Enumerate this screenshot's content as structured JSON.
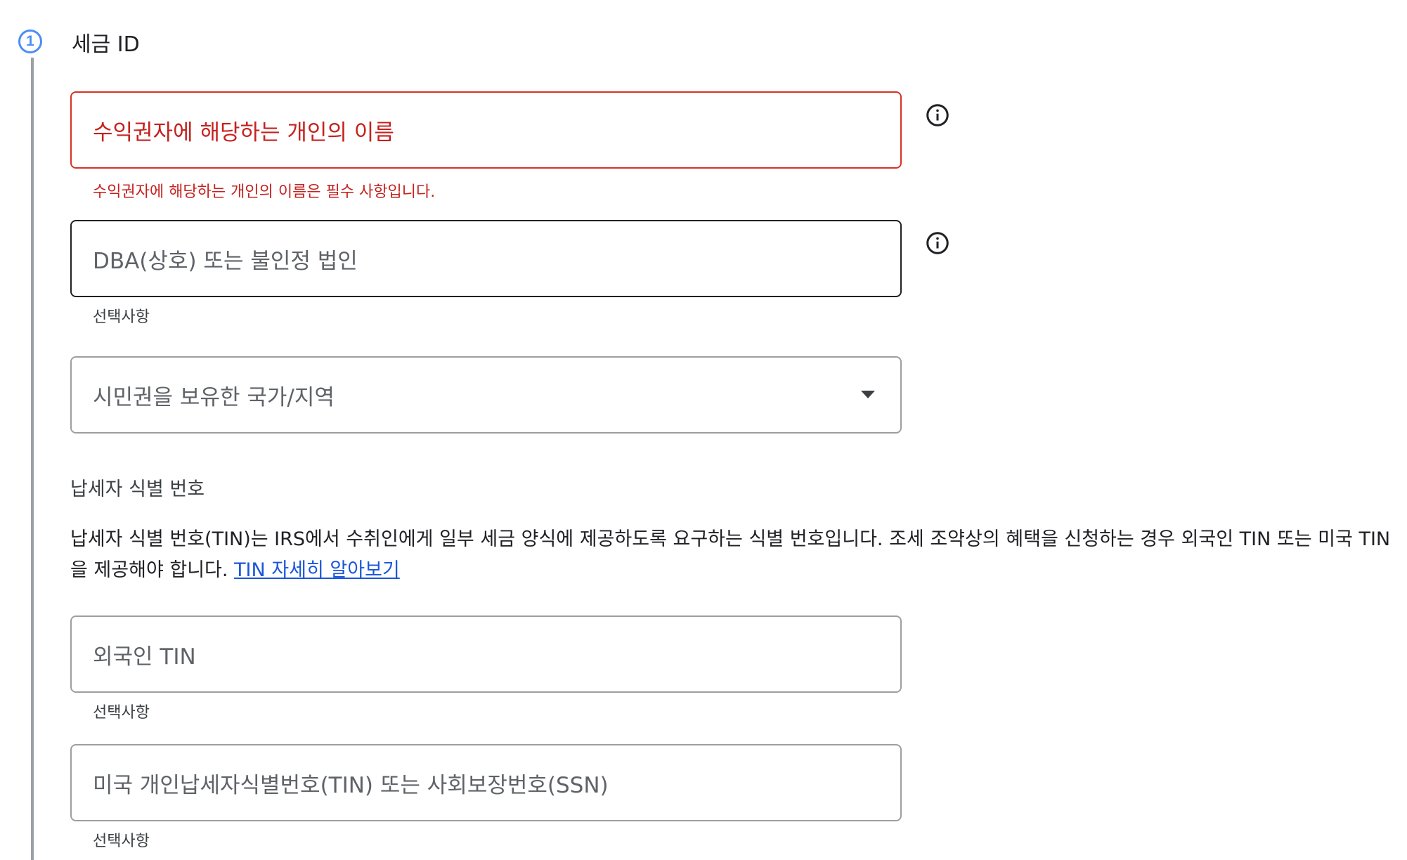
{
  "step": {
    "number": "1",
    "title": "세금 ID"
  },
  "fields": {
    "beneficiary_name": {
      "placeholder": "수익권자에 해당하는 개인의 이름",
      "error": "수익권자에 해당하는 개인의 이름은 필수 사항입니다."
    },
    "dba": {
      "placeholder": "DBA(상호) 또는 불인정 법인",
      "helper": "선택사항"
    },
    "citizenship": {
      "placeholder": "시민권을 보유한 국가/지역"
    },
    "foreign_tin": {
      "placeholder": "외국인 TIN",
      "helper": "선택사항"
    },
    "us_tin": {
      "placeholder": "미국 개인납세자식별번호(TIN) 또는 사회보장번호(SSN)",
      "helper": "선택사항"
    }
  },
  "tin_section": {
    "label": "납세자 식별 번호",
    "description": "납세자 식별 번호(TIN)는 IRS에서 수취인에게 일부 세금 양식에 제공하도록 요구하는 식별 번호입니다. 조세 조약상의 혜택을 신청하는 경우 외국인 TIN 또는 미국 TIN을 제공해야 합니다. ",
    "link": "TIN 자세히 알아보기"
  },
  "icons": {
    "info": "info-icon",
    "dropdown": "dropdown-arrow-icon"
  },
  "colors": {
    "accent": "#4c8df6",
    "error": "#d93025",
    "link": "#1a56db"
  }
}
